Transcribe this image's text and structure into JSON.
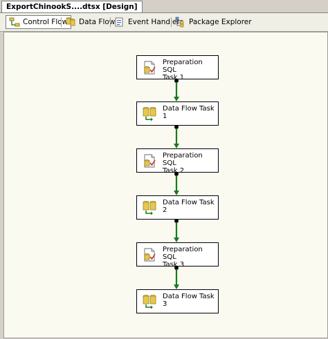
{
  "document": {
    "tab_title": "ExportChinookS....dtsx [Design]"
  },
  "designer_tabs": [
    {
      "label": "Control Flow",
      "icon": "control-flow-icon",
      "active": true
    },
    {
      "label": "Data Flow",
      "icon": "data-flow-icon",
      "active": false
    },
    {
      "label": "Event Handlers",
      "icon": "event-handlers-icon",
      "active": false
    },
    {
      "label": "Package Explorer",
      "icon": "package-explorer-icon",
      "active": false
    }
  ],
  "tasks": [
    {
      "label": "Preparation SQL\nTask 1",
      "type": "sql-task-icon"
    },
    {
      "label": "Data Flow Task\n1",
      "type": "data-flow-task-icon"
    },
    {
      "label": "Preparation SQL\nTask 2",
      "type": "sql-task-icon"
    },
    {
      "label": "Data Flow Task\n2",
      "type": "data-flow-task-icon"
    },
    {
      "label": "Preparation SQL\nTask 3",
      "type": "sql-task-icon"
    },
    {
      "label": "Data Flow Task\n3",
      "type": "data-flow-task-icon"
    }
  ],
  "colors": {
    "connector": "#1a7a1a",
    "canvas_background": "#fbfaf1",
    "window_background": "#d4d0c8"
  }
}
